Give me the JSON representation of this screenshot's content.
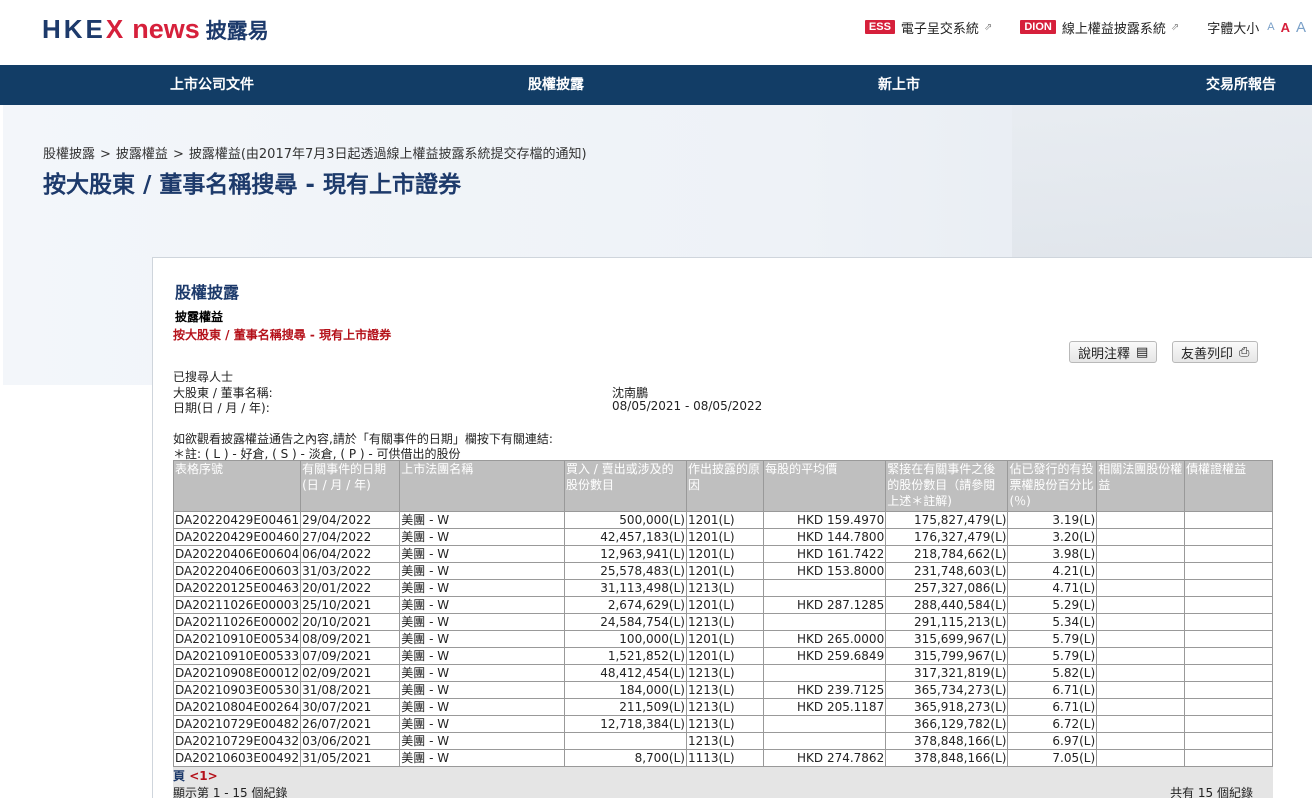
{
  "header": {
    "logo_main": "HKE",
    "logo_x": "X",
    "logo_news": "news",
    "logo_zh": "披露易",
    "links": [
      {
        "badge": "ESS",
        "label": "電子呈交系統"
      },
      {
        "badge": "DION",
        "label": "線上權益披露系統"
      }
    ],
    "font_size_label": "字體大小",
    "font_sizes": [
      "A",
      "A",
      "A"
    ]
  },
  "nav": [
    "上市公司文件",
    "股權披露",
    "新上市",
    "交易所報告"
  ],
  "breadcrumb": [
    "股權披露",
    "披露權益",
    "披露權益(由2017年7月3日起透過線上權益披露系統提交存檔的通知)"
  ],
  "page_title": "按大股東 / 董事名稱搜尋 - 現有上市證券",
  "panel": {
    "section_title": "股權披露",
    "subtitle": "披露權益",
    "sublink": "按大股東 / 董事名稱搜尋 - 現有上市證券",
    "btn_notes": "說明注釋",
    "btn_print": "友善列印"
  },
  "search_info": {
    "searched": "已搜尋人士",
    "name_label": "大股東 / 董事名稱:",
    "name_value": "沈南鵬",
    "date_label": "日期(日 / 月 / 年):",
    "date_value": "08/05/2021 - 08/05/2022"
  },
  "instructions": {
    "line1": "如欲觀看披露權益通告之內容,請於「有關事件的日期」欄按下有關連結:",
    "line2": "＊註: ( L ) - 好倉, ( S ) - 淡倉, ( P ) - 可供借出的股份"
  },
  "table": {
    "headers": [
      "表格序號",
      "有關事件的日期(日 / 月 / 年)",
      "上市法團名稱",
      "買入 / 賣出或涉及的股份數目",
      "作出披露的原因",
      "每股的平均價",
      "緊接在有關事件之後的股份數目（請參閱上述＊註解)",
      "佔已發行的有投票權股份百分比(％)",
      "相關法團股份權益",
      "債權證權益"
    ],
    "rows": [
      [
        "DA20220429E00461",
        "29/04/2022",
        "美團 - W",
        "500,000(L)",
        "1201(L)",
        "HKD 159.4970",
        "175,827,479(L)",
        "3.19(L)",
        "",
        ""
      ],
      [
        "DA20220429E00460",
        "27/04/2022",
        "美團 - W",
        "42,457,183(L)",
        "1201(L)",
        "HKD 144.7800",
        "176,327,479(L)",
        "3.20(L)",
        "",
        ""
      ],
      [
        "DA20220406E00604",
        "06/04/2022",
        "美團 - W",
        "12,963,941(L)",
        "1201(L)",
        "HKD 161.7422",
        "218,784,662(L)",
        "3.98(L)",
        "",
        ""
      ],
      [
        "DA20220406E00603",
        "31/03/2022",
        "美團 - W",
        "25,578,483(L)",
        "1201(L)",
        "HKD 153.8000",
        "231,748,603(L)",
        "4.21(L)",
        "",
        ""
      ],
      [
        "DA20220125E00463",
        "20/01/2022",
        "美團 - W",
        "31,113,498(L)",
        "1213(L)",
        "",
        "257,327,086(L)",
        "4.71(L)",
        "",
        ""
      ],
      [
        "DA20211026E00003",
        "25/10/2021",
        "美團 - W",
        "2,674,629(L)",
        "1201(L)",
        "HKD 287.1285",
        "288,440,584(L)",
        "5.29(L)",
        "",
        ""
      ],
      [
        "DA20211026E00002",
        "20/10/2021",
        "美團 - W",
        "24,584,754(L)",
        "1213(L)",
        "",
        "291,115,213(L)",
        "5.34(L)",
        "",
        ""
      ],
      [
        "DA20210910E00534",
        "08/09/2021",
        "美團 - W",
        "100,000(L)",
        "1201(L)",
        "HKD 265.0000",
        "315,699,967(L)",
        "5.79(L)",
        "",
        ""
      ],
      [
        "DA20210910E00533",
        "07/09/2021",
        "美團 - W",
        "1,521,852(L)",
        "1201(L)",
        "HKD 259.6849",
        "315,799,967(L)",
        "5.79(L)",
        "",
        ""
      ],
      [
        "DA20210908E00012",
        "02/09/2021",
        "美團 - W",
        "48,412,454(L)",
        "1213(L)",
        "",
        "317,321,819(L)",
        "5.82(L)",
        "",
        ""
      ],
      [
        "DA20210903E00530",
        "31/08/2021",
        "美團 - W",
        "184,000(L)",
        "1213(L)",
        "HKD 239.7125",
        "365,734,273(L)",
        "6.71(L)",
        "",
        ""
      ],
      [
        "DA20210804E00264",
        "30/07/2021",
        "美團 - W",
        "211,509(L)",
        "1213(L)",
        "HKD 205.1187",
        "365,918,273(L)",
        "6.71(L)",
        "",
        ""
      ],
      [
        "DA20210729E00482",
        "26/07/2021",
        "美團 - W",
        "12,718,384(L)",
        "1213(L)",
        "",
        "366,129,782(L)",
        "6.72(L)",
        "",
        ""
      ],
      [
        "DA20210729E00432",
        "03/06/2021",
        "美團 - W",
        "",
        "1213(L)",
        "",
        "378,848,166(L)",
        "6.97(L)",
        "",
        ""
      ],
      [
        "DA20210603E00492",
        "31/05/2021",
        "美團 - W",
        "8,700(L)",
        "1113(L)",
        "HKD 274.7862",
        "378,848,166(L)",
        "7.05(L)",
        "",
        ""
      ]
    ]
  },
  "footer": {
    "page_label": "頁",
    "page_current": "<1>",
    "showing": "顯示第 1 - 15 個紀錄",
    "total": "共有 15 個紀錄"
  }
}
